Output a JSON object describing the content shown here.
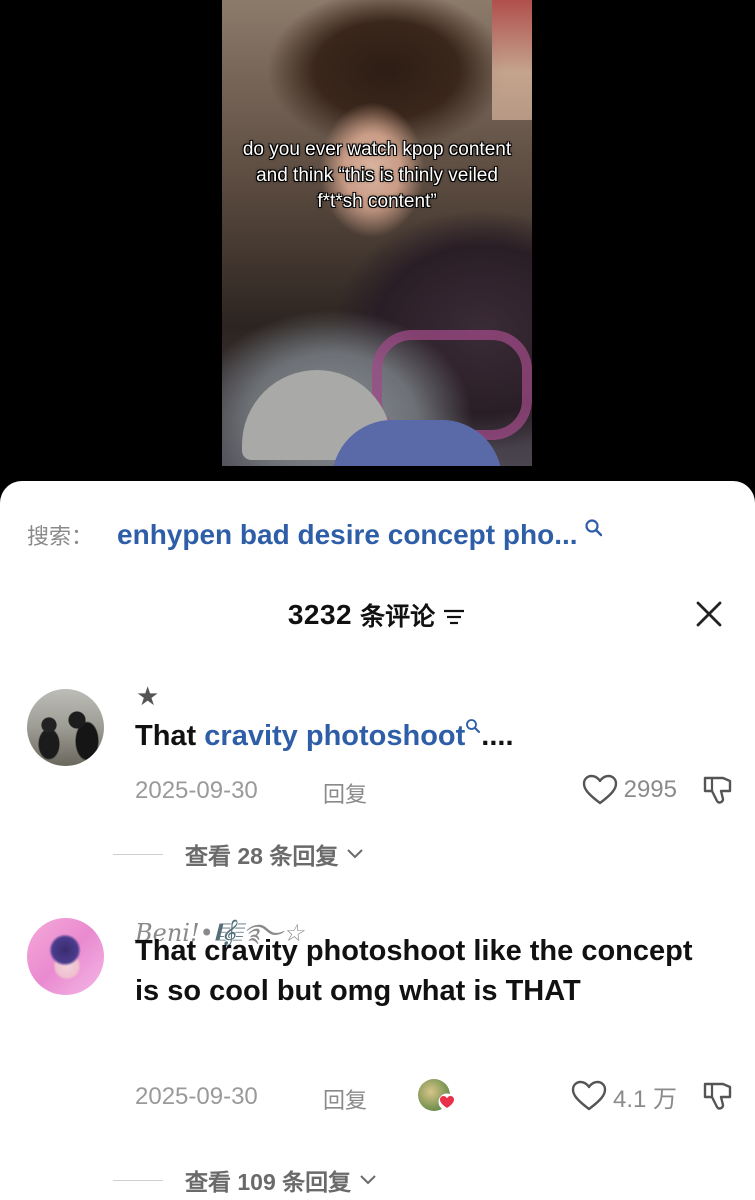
{
  "video": {
    "caption": "do you ever watch kpop content and think “this is thinly veiled f*t*sh content”"
  },
  "search": {
    "label": "搜索：",
    "query": "enhypen bad desire concept pho..."
  },
  "comments_header": {
    "count": "3232",
    "suffix": "条评论"
  },
  "comments": [
    {
      "badge": "★",
      "text_prefix": "That ",
      "mention": "cravity photoshoot",
      "text_suffix": "....",
      "date": "2025-09-30",
      "reply_label": "回复",
      "likes": "2995",
      "view_replies": "查看 28 条回复"
    },
    {
      "username": "Beni!•🎼࿐☆",
      "text": "That cravity photoshoot like the concept is so cool but omg what is THAT",
      "date": "2025-09-30",
      "reply_label": "回复",
      "likes": "4.1 万",
      "view_replies": "查看 109 条回复"
    }
  ],
  "colors": {
    "link_blue": "#2f5ea8",
    "muted_gray": "#8a8a8a",
    "reactor_heart": "#e8304a"
  },
  "icons": [
    "search-icon",
    "filter-icon",
    "close-icon",
    "heart-icon",
    "dislike-icon",
    "chevron-down-icon"
  ]
}
